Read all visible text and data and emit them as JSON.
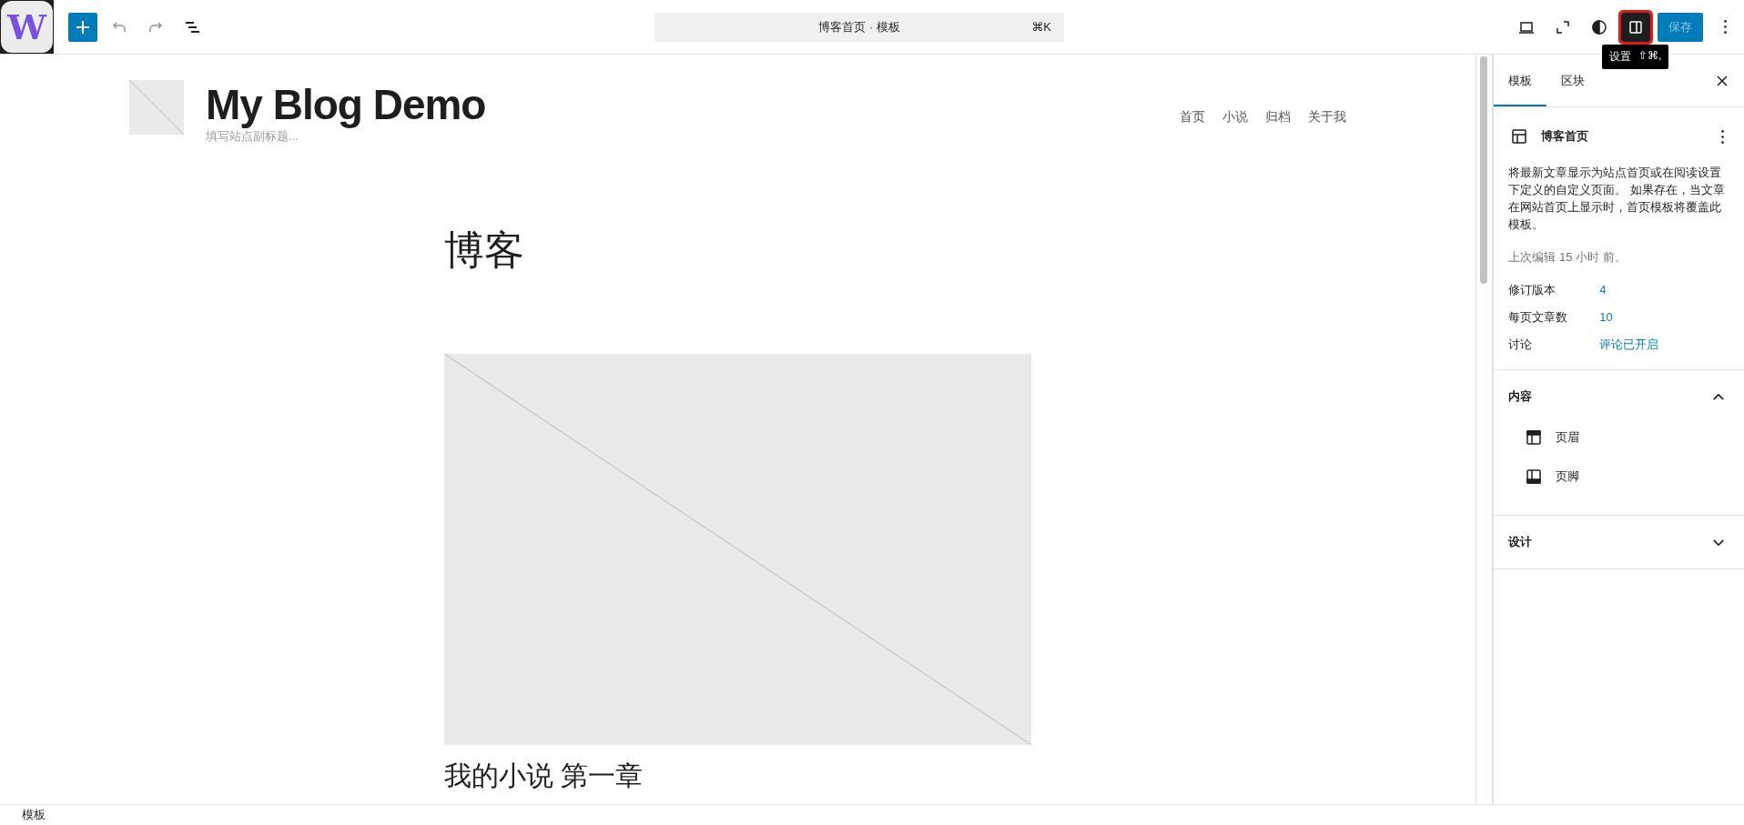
{
  "toolbar": {
    "logo": "W",
    "document_title": "博客首页 · 模板",
    "shortcut": "⌘K",
    "settings_pressed": true,
    "save": "保存",
    "save_disabled": true
  },
  "tooltip": {
    "label": "设置",
    "shortcut": "⇧⌘,"
  },
  "canvas": {
    "site_title": "My Blog Demo",
    "tagline_placeholder": "填写站点副标题...",
    "nav": [
      "首页",
      "小说",
      "归档",
      "关于我"
    ],
    "heading": "博客",
    "post_title": "我的小说 第一章"
  },
  "sidebar": {
    "tabs": [
      {
        "label": "模板",
        "selected": true
      },
      {
        "label": "区块",
        "selected": false
      }
    ],
    "template": {
      "name": "博客首页",
      "description": "将最新文章显示为站点首页或在阅读设置下定义的自定义页面。 如果存在，当文章在网站首页上显示时，首页模板将覆盖此模板。",
      "last_edited": "上次编辑 15 小时 前。"
    },
    "properties": [
      {
        "label": "修订版本",
        "value": "4"
      },
      {
        "label": "每页文章数",
        "value": "10"
      },
      {
        "label": "讨论",
        "value": "评论已开启"
      }
    ],
    "panels": [
      {
        "title": "内容",
        "expanded": true,
        "items": [
          {
            "label": "页眉",
            "kind": "header"
          },
          {
            "label": "页脚",
            "kind": "footer"
          }
        ]
      },
      {
        "title": "设计",
        "expanded": false
      }
    ]
  },
  "status_bar": {
    "breadcrumb": "模板"
  }
}
